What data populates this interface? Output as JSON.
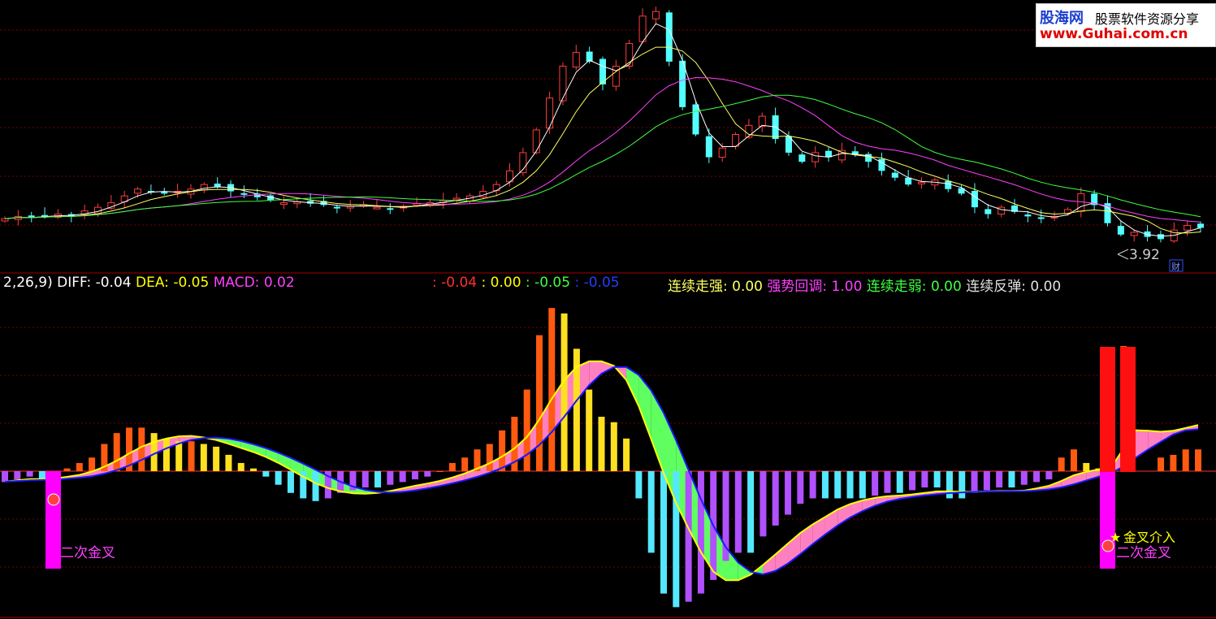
{
  "logo": {
    "name": "股海网",
    "tagline": "股票软件资源分享",
    "url": "www.Guhai.com.cn"
  },
  "colors": {
    "bg": "#000000",
    "up": "#ff3c3c",
    "down": "#54ffff",
    "ma1": "#ffffff",
    "ma2": "#ffff60",
    "ma3": "#ff40ff",
    "ma4": "#40ff40",
    "diff": "#ffff00",
    "dea": "#1a1aff",
    "pinkfill": "#ff80c0",
    "greenfill": "#60ff60"
  },
  "price_panel": {
    "low_label": "3.92",
    "fin_icon_label": "财"
  },
  "indicator_header": {
    "params": "2,26,9)",
    "diff_label": "DIFF:",
    "diff_value": "-0.04",
    "dea_label": "DEA:",
    "dea_value": "-0.05",
    "macd_label": "MACD:",
    "macd_value": "0.02",
    "v1": ": -0.04",
    "v2": ": 0.00",
    "v3": ": -0.05",
    "v4": ": -0.05",
    "s1_label": "连续走强:",
    "s1_value": "0.00",
    "s2_label": "强势回调:",
    "s2_value": "1.00",
    "s3_label": "连续走弱:",
    "s3_value": "0.00",
    "s4_label": "连续反弹:",
    "s4_value": "0.00"
  },
  "signals": {
    "left_label": "二次金叉",
    "right_label": "二次金叉",
    "cross_label": "金叉介入"
  },
  "chart_data": {
    "type": "candlestick+macd",
    "price": {
      "close_seed": [
        4.45,
        4.5,
        4.47,
        4.52,
        4.55,
        4.5,
        4.62,
        4.7,
        4.8,
        4.95,
        5.1,
        5.05,
        5.0,
        5.05,
        5.1,
        5.2,
        5.15,
        5.05,
        5.0,
        4.92,
        4.85,
        4.8,
        4.82,
        4.78,
        4.75,
        4.7,
        4.72,
        4.76,
        4.7,
        4.68,
        4.72,
        4.78,
        4.8,
        4.85,
        4.9,
        4.95,
        5.05,
        5.2,
        5.5,
        5.9,
        6.4,
        7.1,
        7.8,
        8.1,
        7.9,
        7.4,
        7.8,
        8.3,
        8.9,
        9.0,
        7.9,
        6.9,
        6.3,
        5.8,
        6.0,
        6.3,
        6.5,
        6.7,
        6.2,
        5.9,
        5.7,
        5.9,
        5.8,
        5.95,
        5.85,
        5.7,
        5.5,
        5.35,
        5.2,
        5.25,
        5.3,
        5.1,
        5.0,
        4.7,
        4.55,
        4.7,
        4.6,
        4.5,
        4.45,
        4.5,
        4.65,
        5.0,
        4.75,
        4.35,
        4.1,
        4.15,
        4.05,
        4.0,
        4.2,
        4.3,
        4.25
      ],
      "ymin": 3.9,
      "ymax": 9.2
    },
    "macd": {
      "bars": [
        -0.04,
        -0.03,
        -0.02,
        -0.03,
        -0.02,
        0.01,
        0.03,
        0.05,
        0.1,
        0.14,
        0.16,
        0.16,
        0.14,
        0.12,
        0.11,
        0.11,
        0.1,
        0.09,
        0.06,
        0.03,
        0.01,
        -0.02,
        -0.05,
        -0.08,
        -0.1,
        -0.11,
        -0.1,
        -0.08,
        -0.07,
        -0.06,
        -0.06,
        -0.05,
        -0.04,
        -0.03,
        -0.02,
        0.0,
        0.03,
        0.05,
        0.08,
        0.1,
        0.15,
        0.2,
        0.3,
        0.5,
        0.6,
        0.58,
        0.45,
        0.3,
        0.2,
        0.18,
        0.12,
        -0.1,
        -0.3,
        -0.45,
        -0.5,
        -0.48,
        -0.45,
        -0.4,
        -0.33,
        -0.3,
        -0.3,
        -0.24,
        -0.2,
        -0.16,
        -0.12,
        -0.1,
        -0.1,
        -0.1,
        -0.1,
        -0.1,
        -0.09,
        -0.08,
        -0.08,
        -0.07,
        -0.06,
        -0.06,
        -0.1,
        -0.1,
        -0.08,
        -0.07,
        -0.06,
        -0.06,
        -0.05,
        -0.04,
        -0.03,
        0.05,
        0.08,
        0.03,
        0.01,
        0.0,
        0.46,
        0.46,
        0.04,
        0.05,
        0.06,
        0.08,
        0.08
      ],
      "ymin": -0.55,
      "ymax": 0.65
    }
  }
}
